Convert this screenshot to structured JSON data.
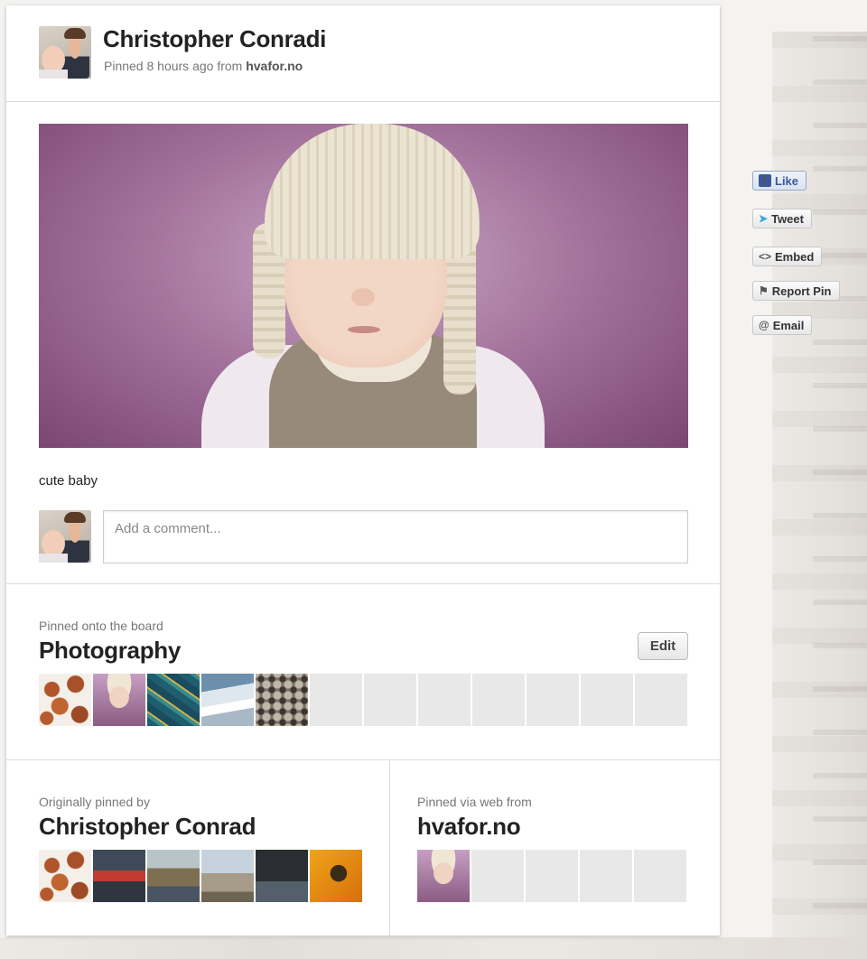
{
  "pin": {
    "author_name": "Christopher Conradi",
    "meta_prefix": "Pinned 8 hours ago from",
    "meta_source": "hvafor.no",
    "caption": "cute baby"
  },
  "comment": {
    "placeholder": "Add a comment..."
  },
  "board": {
    "label": "Pinned onto the board",
    "name": "Photography",
    "edit_label": "Edit",
    "thumbnails": [
      "cars",
      "baby",
      "teal-abstract",
      "snow-landscape",
      "floral-pattern",
      "",
      "",
      "",
      "",
      "",
      "",
      ""
    ]
  },
  "original": {
    "label": "Originally pinned by",
    "name": "Christopher Conrad",
    "thumbnails": [
      "cars",
      "people",
      "outdoor",
      "beach",
      "dark-street",
      "orange"
    ]
  },
  "via": {
    "label": "Pinned via web from",
    "name": "hvafor.no",
    "thumbnails": [
      "baby",
      "",
      "",
      "",
      ""
    ]
  },
  "actions": {
    "like": "Like",
    "tweet": "Tweet",
    "embed": "Embed",
    "report": "Report Pin",
    "email": "Email"
  },
  "icons": {
    "like": "facebook-icon",
    "tweet": "twitter-bird-icon",
    "embed": "code-brackets-icon",
    "report": "flag-icon",
    "email": "at-sign-icon"
  },
  "colors": {
    "facebook": "#3b5998",
    "twitter": "#3aa7e0",
    "text": "#222222",
    "muted": "#777777"
  }
}
